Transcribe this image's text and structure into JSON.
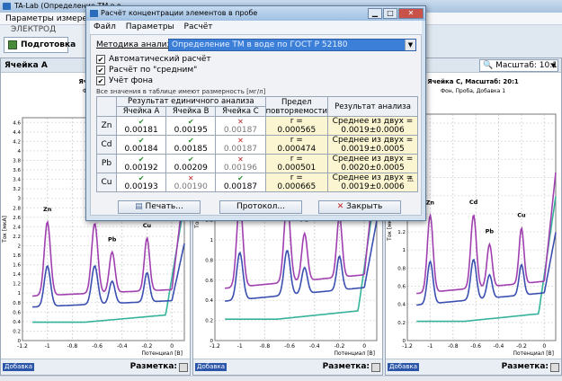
{
  "main_window": {
    "title": "TA-Lab (Определение ТМ в в",
    "menu_item": "Параметры измерен",
    "group_label": "ЭЛЕКТРОД",
    "tab_label": "Подготовка",
    "status_text": ""
  },
  "panels": [
    {
      "header": "Ячейка А",
      "subtitle": "Ячейка А",
      "subtitle2": "Фон, Про"
    },
    {
      "header": "",
      "subtitle": "",
      "subtitle2": ""
    },
    {
      "header": "",
      "subtitle": "Ячейка С, Масштаб: 20:1",
      "subtitle2": "Фон, Проба, Добавка 1"
    }
  ],
  "zoom": {
    "label": "Масштаб:",
    "value": "10:1"
  },
  "footer": {
    "add_label": "Добавка",
    "markup_label": "Разметка:"
  },
  "dialog": {
    "title": "Расчёт концентрации элементов в пробе",
    "menu": [
      "Файл",
      "Параметры",
      "Расчёт"
    ],
    "method_label": "Методика анализа:",
    "method_value": "Определение ТМ в воде по ГОСТ Р 52180",
    "checkboxes": [
      {
        "label": "Автоматический расчёт",
        "checked": true
      },
      {
        "label": "Расчёт по \"средним\"",
        "checked": true
      },
      {
        "label": "Учёт фона",
        "checked": true
      }
    ],
    "units_note": "Все значения в таблице имеют размерность [мг/л]",
    "table": {
      "header_single": "Результат единичного анализа",
      "header_limit": "Предел повторяемости",
      "header_result": "Результат анализа",
      "cells": [
        "Ячейка А",
        "Ячейка В",
        "Ячейка С"
      ],
      "rows": [
        {
          "el": "Zn",
          "vals": [
            {
              "v": "0.00181",
              "ok": true
            },
            {
              "v": "0.00195",
              "ok": true
            },
            {
              "v": "0.00187",
              "ok": false
            }
          ],
          "limit": [
            "r =",
            "0.000565"
          ],
          "result": [
            "Среднее из двух =",
            "0.0019±0.0006"
          ],
          "warn": false
        },
        {
          "el": "Cd",
          "vals": [
            {
              "v": "0.00184",
              "ok": true
            },
            {
              "v": "0.00185",
              "ok": true
            },
            {
              "v": "0.00187",
              "ok": false
            }
          ],
          "limit": [
            "r =",
            "0.000474"
          ],
          "result": [
            "Среднее из двух =",
            "0.0019±0.0005"
          ],
          "warn": false
        },
        {
          "el": "Pb",
          "vals": [
            {
              "v": "0.00192",
              "ok": true
            },
            {
              "v": "0.00209",
              "ok": true
            },
            {
              "v": "0.00196",
              "ok": false
            }
          ],
          "limit": [
            "r =",
            "0.000501"
          ],
          "result": [
            "Среднее из двух =",
            "0.0020±0.0005"
          ],
          "warn": false
        },
        {
          "el": "Cu",
          "vals": [
            {
              "v": "0.00193",
              "ok": true
            },
            {
              "v": "0.00190",
              "ok": false
            },
            {
              "v": "0.00187",
              "ok": true
            }
          ],
          "limit": [
            "r =",
            "0.000665"
          ],
          "result": [
            "Среднее из двух =",
            "0.0019±0.0006"
          ],
          "warn": true
        }
      ]
    },
    "buttons": {
      "print": "Печать...",
      "report": "Протокол...",
      "close": "Закрыть"
    }
  },
  "chart_data": [
    {
      "type": "line",
      "ylabel": "Ток [мкА]",
      "xlabel": "Потенциал [В]",
      "x_ticks": [
        "-1.2",
        "-1",
        "-0.8",
        "-0.6",
        "-0.4",
        "-0.2",
        "0"
      ],
      "y_ticks": [
        "0",
        "0.2",
        "0.4",
        "0.6",
        "0.8",
        "1",
        "1.2",
        "1.4",
        "1.6",
        "1.8",
        "2",
        "2.2",
        "2.4",
        "2.6",
        "2.8",
        "3",
        "3.2",
        "3.4",
        "3.6",
        "3.8",
        "4",
        "4.2",
        "4.4",
        "4.6"
      ],
      "xlim": [
        -1.2,
        0.1
      ],
      "ylim": [
        0,
        4.7
      ],
      "peak_labels": [
        "Zn",
        "Cd",
        "Pb",
        "Cu"
      ]
    },
    {
      "type": "line",
      "ylabel": "Ток [мкА]",
      "xlabel": "Потенциал [В]",
      "x_ticks": [
        "-1.2",
        "-1",
        "-0.8",
        "-0.6",
        "-0.4",
        "-0.2",
        "0"
      ],
      "y_ticks": [
        "0",
        "0.2",
        "0.4",
        "0.6",
        "0.8",
        "1",
        "1.2",
        "1.4",
        "1.6",
        "1.8",
        "2",
        "2.2",
        "2.4"
      ],
      "xlim": [
        -1.2,
        0.1
      ],
      "ylim": [
        0,
        2.5
      ],
      "peak_labels": [
        "Zn",
        "Cd",
        "Pb",
        "Cu"
      ]
    },
    {
      "type": "line",
      "ylabel": "Ток [мкА]",
      "xlabel": "Потенциал [В]",
      "x_ticks": [
        "-1.2",
        "-1",
        "-0.8",
        "-0.6",
        "-0.4",
        "-0.2",
        "0"
      ],
      "y_ticks": [
        "0",
        "0.2",
        "0.4",
        "0.6",
        "0.8",
        "1",
        "1.2",
        "1.4",
        "1.6",
        "1.8",
        "2",
        "2.2",
        "2.4"
      ],
      "xlim": [
        -1.2,
        0.1
      ],
      "ylim": [
        0,
        2.5
      ],
      "peak_labels": [
        "Zn",
        "Cd",
        "Pb",
        "Cu"
      ]
    }
  ],
  "colors": {
    "curve_fon": "#35b39a",
    "curve_proba": "#3a4fb0",
    "curve_dobavka": "#a040b0",
    "accent": "#3b7fd8"
  }
}
